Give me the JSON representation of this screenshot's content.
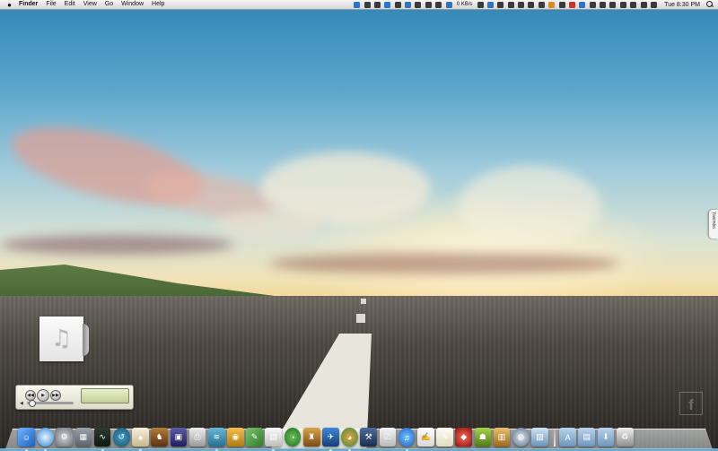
{
  "menubar": {
    "app": "Finder",
    "items": [
      "File",
      "Edit",
      "View",
      "Go",
      "Window",
      "Help"
    ],
    "status_icons": [
      {
        "name": "display-icon",
        "color": "#2a74c9"
      },
      {
        "name": "music-note-icon",
        "color": "#3a3a3a"
      },
      {
        "name": "alien-icon",
        "color": "#3a3a3a"
      },
      {
        "name": "twitter-bird-icon",
        "color": "#2a74c9"
      },
      {
        "name": "gear-badge-icon",
        "color": "#3a3a3a"
      },
      {
        "name": "dropbox-icon",
        "color": "#2a74c9"
      },
      {
        "name": "eye-icon",
        "color": "#3a3a3a"
      },
      {
        "name": "cloud-icon",
        "color": "#3a3a3a"
      },
      {
        "name": "clock-icon",
        "color": "#3a3a3a"
      },
      {
        "name": "facebook-icon",
        "color": "#2a74c9"
      }
    ],
    "network_speed": "0 KB/s",
    "status_icons_right": [
      {
        "name": "x-tools-icon",
        "color": "#3a3a3a"
      },
      {
        "name": "skype-icon",
        "color": "#2a74c9"
      },
      {
        "name": "cpu-icon",
        "color": "#3a3a3a"
      },
      {
        "name": "circle-icon",
        "color": "#3a3a3a"
      },
      {
        "name": "chat-bubble-icon",
        "color": "#3a3a3a"
      },
      {
        "name": "eye-icon",
        "color": "#3a3a3a"
      },
      {
        "name": "download-icon",
        "color": "#3a3a3a"
      },
      {
        "name": "wifi-signal-icon",
        "color": "#e08a1c"
      },
      {
        "name": "lock-icon",
        "color": "#3a3a3a"
      },
      {
        "name": "flag-icon",
        "color": "#c8332e"
      },
      {
        "name": "facebook-icon",
        "color": "#2a74c9"
      },
      {
        "name": "grid-icon",
        "color": "#3a3a3a"
      },
      {
        "name": "battery-icon",
        "color": "#3a3a3a"
      },
      {
        "name": "sync-icon",
        "color": "#3a3a3a"
      },
      {
        "name": "time-machine-icon",
        "color": "#3a3a3a"
      },
      {
        "name": "bluetooth-icon",
        "color": "#3a3a3a"
      },
      {
        "name": "wifi-icon",
        "color": "#3a3a3a"
      },
      {
        "name": "volume-icon",
        "color": "#3a3a3a"
      }
    ],
    "clock": "Tue 8:30 PM"
  },
  "widget": {
    "screen_symbol": "",
    "controls": [
      "previous-button",
      "play-button",
      "next-button"
    ]
  },
  "side_tab": {
    "label": "Yasimbo"
  },
  "desktop_file": {
    "icon": "music-note-icon"
  },
  "dock": {
    "left_apps": [
      {
        "name": "finder-icon",
        "bg": "linear-gradient(135deg,#6fb6ff,#1d5fc0)",
        "glyph": "☺",
        "running": true
      },
      {
        "name": "safari-icon",
        "bg": "radial-gradient(circle,#e8f4ff,#2e86d6)",
        "glyph": "",
        "round": true,
        "running": true
      },
      {
        "name": "system-preferences-icon",
        "bg": "radial-gradient(circle,#cfd3d8,#6c7178)",
        "glyph": "⚙",
        "round": false,
        "running": false
      },
      {
        "name": "dashboard-icon",
        "bg": "linear-gradient(180deg,#9aa3ab,#5b6168)",
        "glyph": "▦",
        "running": false
      },
      {
        "name": "activity-monitor-icon",
        "bg": "linear-gradient(180deg,#2c3a30,#0e1a12)",
        "glyph": "∿",
        "running": true
      },
      {
        "name": "time-machine-icon",
        "bg": "radial-gradient(circle,#3f9ec9,#1c4f66)",
        "glyph": "↺",
        "round": true,
        "running": false
      },
      {
        "name": "solitaire-icon",
        "bg": "linear-gradient(180deg,#f6f0da,#c8b98d)",
        "glyph": "♠",
        "running": true
      },
      {
        "name": "chess-icon",
        "bg": "linear-gradient(180deg,#b57c3a,#5a3312)",
        "glyph": "♞",
        "running": false
      },
      {
        "name": "photo-booth-icon",
        "bg": "linear-gradient(180deg,#5c5ca8,#1f1f5c)",
        "glyph": "▣",
        "running": false
      },
      {
        "name": "printer-icon",
        "bg": "linear-gradient(180deg,#eeeeee,#9a9a9a)",
        "glyph": "⎙",
        "running": false
      },
      {
        "name": "network-utility-icon",
        "bg": "linear-gradient(180deg,#6ab7d8,#24708f)",
        "glyph": "≋",
        "running": true
      },
      {
        "name": "airport-utility-icon",
        "bg": "linear-gradient(180deg,#f2c14c,#b07a12)",
        "glyph": "◉",
        "running": false
      },
      {
        "name": "preview-icon",
        "bg": "linear-gradient(135deg,#7ec26b,#2e7d2a)",
        "glyph": "✎",
        "running": false
      },
      {
        "name": "ebook-reader-icon",
        "bg": "linear-gradient(180deg,#fafafa,#bdbdbd)",
        "glyph": "▤",
        "running": true
      },
      {
        "name": "disk-speed-gauge-icon",
        "bg": "radial-gradient(circle,#66c25a,#1e6d1b)",
        "glyph": "◔",
        "round": true,
        "running": false
      },
      {
        "name": "alfred-hat-icon",
        "bg": "linear-gradient(180deg,#d9a44a,#7a4a14)",
        "glyph": "♜",
        "running": false
      },
      {
        "name": "tweetdeck-icon",
        "bg": "linear-gradient(180deg,#3d88d6,#173f7a)",
        "glyph": "✈",
        "running": true
      },
      {
        "name": "adium-icon",
        "bg": "radial-gradient(circle,#f0a040,#2e8f3c)",
        "glyph": "◕",
        "round": true,
        "running": true
      },
      {
        "name": "hammer-tool-icon",
        "bg": "linear-gradient(180deg,#4a6d9e,#1e2e4d)",
        "glyph": "⚒",
        "running": false
      },
      {
        "name": "image-capture-icon",
        "bg": "linear-gradient(180deg,#f5f5f5,#b8b8b8)",
        "glyph": "⎚",
        "running": false
      },
      {
        "name": "itunes-icon",
        "bg": "radial-gradient(circle,#6fc3ff,#1f5fc6)",
        "glyph": "♫",
        "round": true,
        "running": true
      },
      {
        "name": "textedit-icon",
        "bg": "linear-gradient(180deg,#ffffff,#d6d6d6)",
        "glyph": "✍",
        "running": false
      },
      {
        "name": "notes-icon",
        "bg": "linear-gradient(180deg,#fffdf2,#e0dcc0)",
        "glyph": "✎",
        "running": false
      },
      {
        "name": "ruby-gem-icon",
        "bg": "radial-gradient(circle,#ff6a5a,#8b0f0a)",
        "glyph": "◆",
        "running": false
      },
      {
        "name": "android-icon",
        "bg": "linear-gradient(180deg,#a7d34a,#4f7d14)",
        "glyph": "☗",
        "running": false
      },
      {
        "name": "archive-utility-icon",
        "bg": "linear-gradient(180deg,#e7c06c,#9c6a1d)",
        "glyph": "▥",
        "running": false
      },
      {
        "name": "network-globe-icon",
        "bg": "radial-gradient(circle,#d9e3ee,#59718a)",
        "glyph": "◍",
        "round": true,
        "running": false
      },
      {
        "name": "wallpaper-preview-icon",
        "bg": "linear-gradient(180deg,#cfe4f5,#6a93b8)",
        "glyph": "▨",
        "running": false
      }
    ],
    "right_items": [
      {
        "name": "applications-folder-icon",
        "bg": "linear-gradient(180deg,#b8d3ec,#6e96bd)",
        "glyph": "A"
      },
      {
        "name": "documents-folder-icon",
        "bg": "linear-gradient(180deg,#b8d3ec,#6e96bd)",
        "glyph": "▤"
      },
      {
        "name": "downloads-folder-icon",
        "bg": "linear-gradient(180deg,#b8d3ec,#6e96bd)",
        "glyph": "⬇"
      },
      {
        "name": "trash-icon",
        "bg": "linear-gradient(180deg,#f0f0f0,#8d8d8d)",
        "glyph": "♻"
      }
    ]
  }
}
